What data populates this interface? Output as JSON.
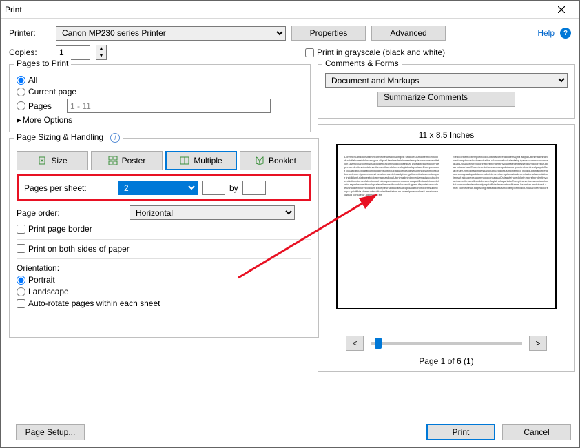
{
  "title": "Print",
  "help_label": "Help",
  "printer": {
    "label": "Printer:",
    "value": "Canon MP230 series Printer",
    "properties_btn": "Properties",
    "advanced_btn": "Advanced"
  },
  "copies": {
    "label": "Copies:",
    "value": "1"
  },
  "grayscale_label": "Print in grayscale (black and white)",
  "pages_to_print": {
    "legend": "Pages to Print",
    "all": "All",
    "current": "Current page",
    "pages": "Pages",
    "pages_value": "1 - 11",
    "more_options": "More Options"
  },
  "sizing": {
    "legend": "Page Sizing & Handling",
    "size": "Size",
    "poster": "Poster",
    "multiple": "Multiple",
    "booklet": "Booklet",
    "pps_label": "Pages per sheet:",
    "pps_value": "2",
    "by": "by",
    "page_order_label": "Page order:",
    "page_order_value": "Horizontal",
    "print_page_border": "Print page border",
    "print_both_sides": "Print on both sides of paper",
    "orientation_label": "Orientation:",
    "portrait": "Portrait",
    "landscape": "Landscape",
    "auto_rotate": "Auto-rotate pages within each sheet"
  },
  "comments": {
    "legend": "Comments & Forms",
    "value": "Document and Markups",
    "summarize": "Summarize Comments"
  },
  "preview": {
    "dimensions": "11 x 8.5 Inches",
    "page_indicator": "Page 1 of 6 (1)"
  },
  "buttons": {
    "page_setup": "Page Setup...",
    "print": "Print",
    "cancel": "Cancel"
  }
}
